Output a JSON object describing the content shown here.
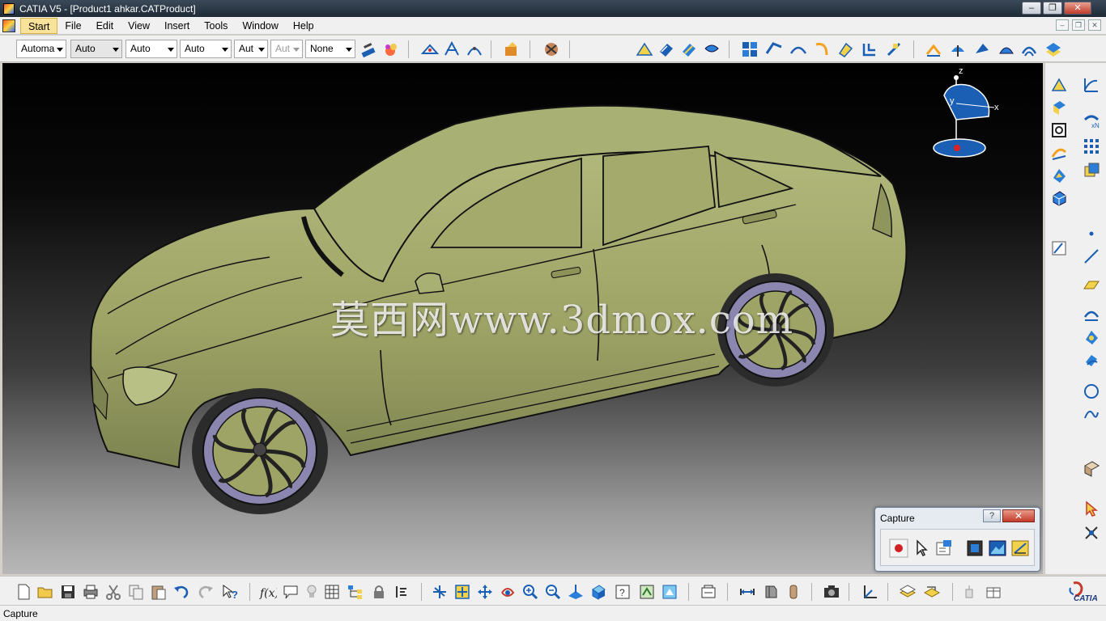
{
  "window": {
    "title": "CATIA V5 - [Product1 ahkar.CATProduct]",
    "minimize": "‒",
    "restore": "❐",
    "close": "✕"
  },
  "menu": {
    "items": [
      "Start",
      "File",
      "Edit",
      "View",
      "Insert",
      "Tools",
      "Window",
      "Help"
    ],
    "mdi_minimize": "‒",
    "mdi_restore": "❐",
    "mdi_close": "✕"
  },
  "toolbar": {
    "combo_1": "Automa",
    "combo_2": "Auto",
    "combo_3": "Auto",
    "combo_4": "Auto",
    "combo_5": "Aut",
    "combo_6": "Aut",
    "combo_7": "None"
  },
  "viewport": {
    "watermark": "莫西网www.3dmox.com",
    "compass_z": "z",
    "compass_y": "y",
    "compass_x": "x"
  },
  "capture_dialog": {
    "title": "Capture",
    "help": "?",
    "close": "✕"
  },
  "status": {
    "text": "Capture"
  },
  "brand": {
    "logo_text": "CATIA"
  },
  "colors": {
    "car_body": "#a6ad6f",
    "wheel_rim": "#8a86b0",
    "accent_blue": "#1a5fb4",
    "highlight": "#f9e29a"
  }
}
